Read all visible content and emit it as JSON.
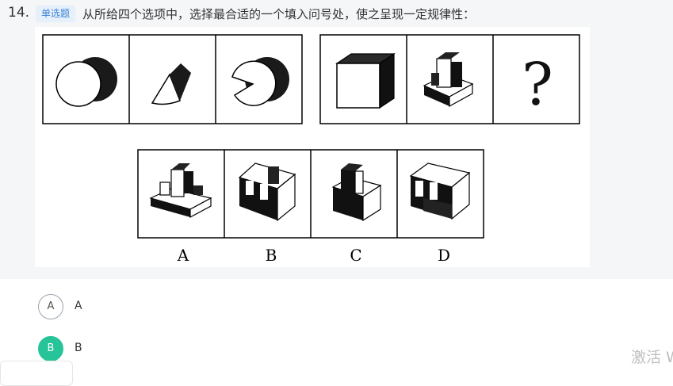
{
  "question": {
    "number": "14.",
    "type_badge": "单选题",
    "text": "从所给四个选项中，选择最合适的一个填入问号处，使之呈现一定规律性："
  },
  "figure": {
    "question_mark": "?",
    "option_labels": [
      "A",
      "B",
      "C",
      "D"
    ]
  },
  "answers": [
    {
      "letter": "A",
      "text": "A",
      "selected": false
    },
    {
      "letter": "B",
      "text": "B",
      "selected": true
    }
  ],
  "watermark": "激活 W",
  "colors": {
    "accent": "#27c49a",
    "badge_bg": "#e6f0fb",
    "badge_text": "#3b82d6"
  }
}
